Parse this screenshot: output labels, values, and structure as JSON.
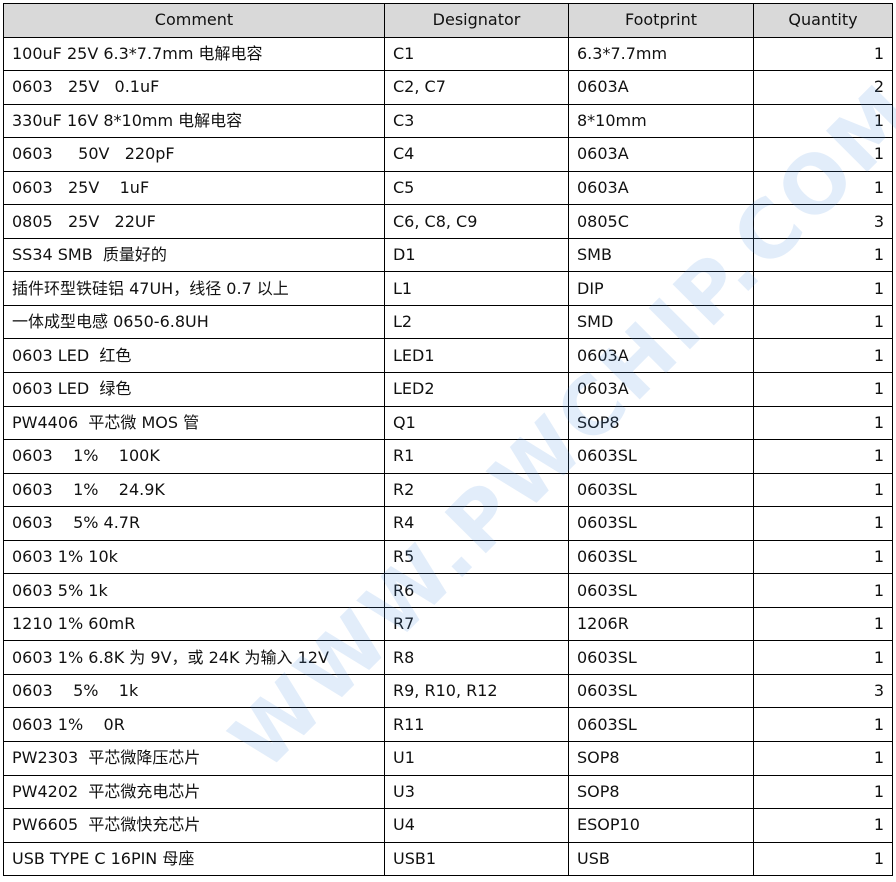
{
  "headers": {
    "comment": "Comment",
    "designator": "Designator",
    "footprint": "Footprint",
    "quantity": "Quantity"
  },
  "rows": [
    {
      "comment": "100uF 25V 6.3*7.7mm 电解电容",
      "designator": "C1",
      "footprint": "6.3*7.7mm",
      "quantity": "1"
    },
    {
      "comment": "0603   25V   0.1uF",
      "designator": "C2, C7",
      "footprint": "0603A",
      "quantity": "2"
    },
    {
      "comment": "330uF 16V 8*10mm 电解电容",
      "designator": "C3",
      "footprint": "8*10mm",
      "quantity": "1"
    },
    {
      "comment": "0603     50V   220pF",
      "designator": "C4",
      "footprint": "0603A",
      "quantity": "1"
    },
    {
      "comment": "0603   25V    1uF",
      "designator": "C5",
      "footprint": "0603A",
      "quantity": "1"
    },
    {
      "comment": "0805   25V   22UF",
      "designator": "C6, C8, C9",
      "footprint": "0805C",
      "quantity": "3"
    },
    {
      "comment": "SS34 SMB  质量好的",
      "designator": "D1",
      "footprint": "SMB",
      "quantity": "1"
    },
    {
      "comment": "插件环型铁硅铝 47UH，线径 0.7 以上",
      "designator": "L1",
      "footprint": "DIP",
      "quantity": "1"
    },
    {
      "comment": "一体成型电感 0650-6.8UH",
      "designator": "L2",
      "footprint": "SMD",
      "quantity": "1"
    },
    {
      "comment": "0603 LED  红色",
      "designator": "LED1",
      "footprint": "0603A",
      "quantity": "1"
    },
    {
      "comment": "0603 LED  绿色",
      "designator": "LED2",
      "footprint": "0603A",
      "quantity": "1"
    },
    {
      "comment": "PW4406  平芯微 MOS 管",
      "designator": "Q1",
      "footprint": "SOP8",
      "quantity": "1"
    },
    {
      "comment": "0603    1%    100K",
      "designator": "R1",
      "footprint": "0603SL",
      "quantity": "1"
    },
    {
      "comment": "0603    1%    24.9K",
      "designator": "R2",
      "footprint": "0603SL",
      "quantity": "1"
    },
    {
      "comment": "0603    5% 4.7R",
      "designator": "R4",
      "footprint": "0603SL",
      "quantity": "1"
    },
    {
      "comment": "0603 1% 10k",
      "designator": "R5",
      "footprint": "0603SL",
      "quantity": "1"
    },
    {
      "comment": "0603 5% 1k",
      "designator": "R6",
      "footprint": "0603SL",
      "quantity": "1"
    },
    {
      "comment": "1210 1% 60mR",
      "designator": "R7",
      "footprint": "1206R",
      "quantity": "1"
    },
    {
      "comment": "0603 1% 6.8K 为 9V，或 24K 为输入 12V",
      "designator": "R8",
      "footprint": "0603SL",
      "quantity": "1"
    },
    {
      "comment": "0603    5%    1k",
      "designator": "R9, R10, R12",
      "footprint": "0603SL",
      "quantity": "3"
    },
    {
      "comment": "0603 1%    0R",
      "designator": "R11",
      "footprint": "0603SL",
      "quantity": "1"
    },
    {
      "comment": "PW2303  平芯微降压芯片",
      "designator": "U1",
      "footprint": "SOP8",
      "quantity": "1"
    },
    {
      "comment": "PW4202  平芯微充电芯片",
      "designator": "U3",
      "footprint": "SOP8",
      "quantity": "1"
    },
    {
      "comment": "PW6605  平芯微快充芯片",
      "designator": "U4",
      "footprint": "ESOP10",
      "quantity": "1"
    },
    {
      "comment": "USB TYPE C 16PIN 母座",
      "designator": "USB1",
      "footprint": "USB",
      "quantity": "1"
    }
  ],
  "watermark": "WWW.PWCHIP.COM"
}
